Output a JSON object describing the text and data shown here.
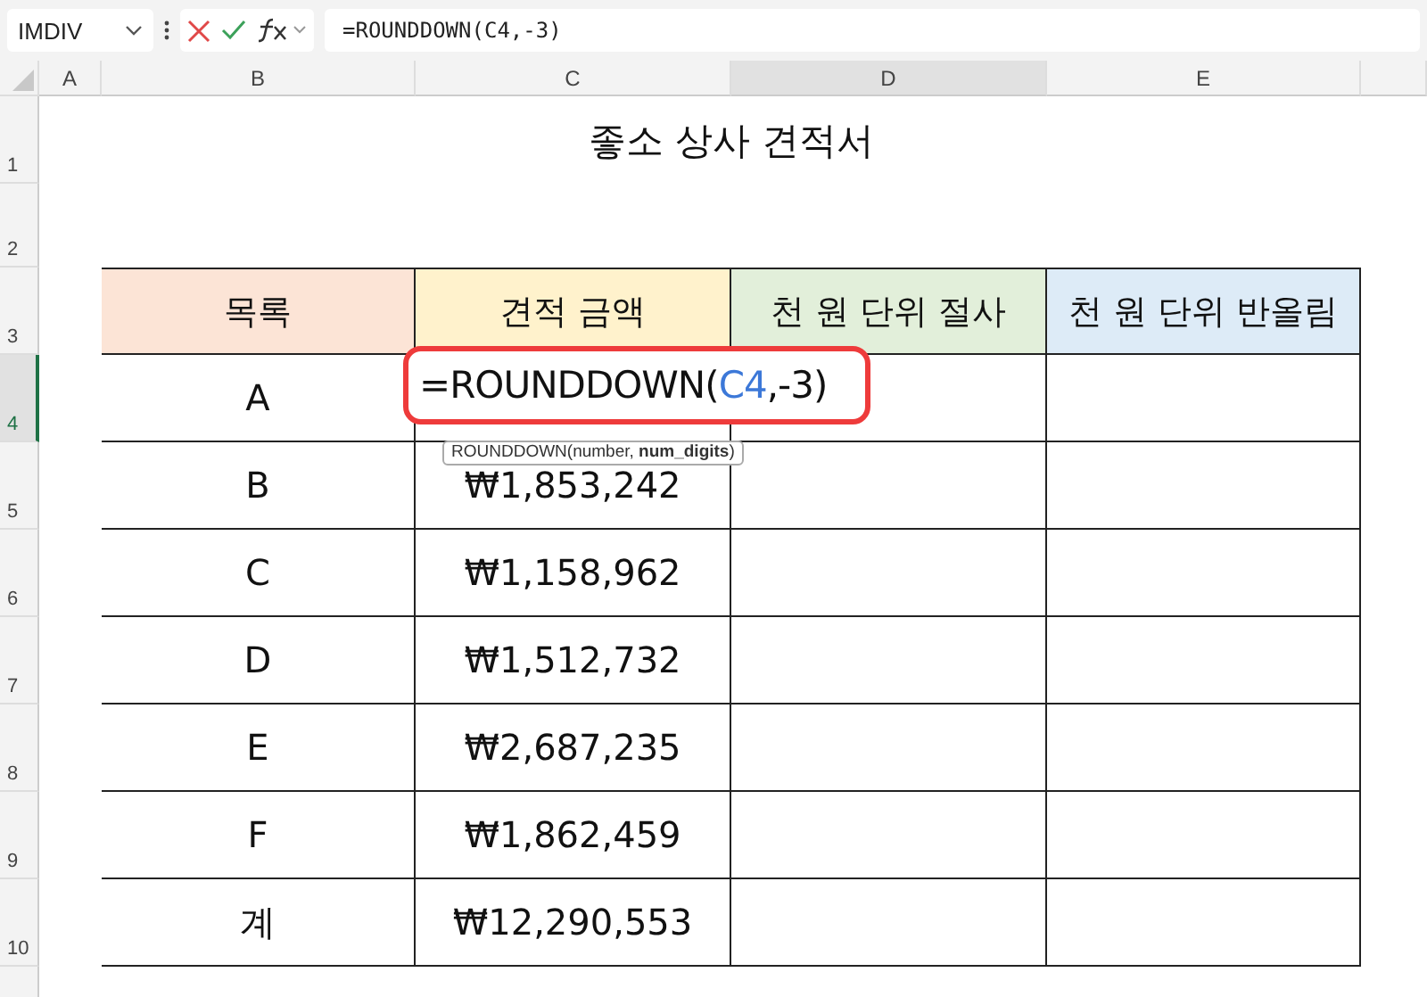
{
  "formula_bar": {
    "name_box": "IMDIV",
    "formula": "=ROUNDDOWN(C4,-3)"
  },
  "columns": [
    {
      "label": "A",
      "selected": false
    },
    {
      "label": "B",
      "selected": false
    },
    {
      "label": "C",
      "selected": false
    },
    {
      "label": "D",
      "selected": true
    },
    {
      "label": "E",
      "selected": false
    }
  ],
  "row_numbers": [
    {
      "label": "1",
      "selected": false
    },
    {
      "label": "2",
      "selected": false
    },
    {
      "label": "3",
      "selected": false
    },
    {
      "label": "4",
      "selected": true
    },
    {
      "label": "5",
      "selected": false
    },
    {
      "label": "6",
      "selected": false
    },
    {
      "label": "7",
      "selected": false
    },
    {
      "label": "8",
      "selected": false
    },
    {
      "label": "9",
      "selected": false
    },
    {
      "label": "10",
      "selected": false
    }
  ],
  "title": "좋소 상사 견적서",
  "table_headers": [
    {
      "text": "목록",
      "color": "#fce4d6"
    },
    {
      "text": "견적 금액",
      "color": "#fff2cc"
    },
    {
      "text": "천 원 단위 절사",
      "color": "#e2efda"
    },
    {
      "text": "천 원 단위 반올림",
      "color": "#ddebf7"
    }
  ],
  "table_rows": [
    {
      "item": "A",
      "amount": ""
    },
    {
      "item": "B",
      "amount": "₩1,853,242"
    },
    {
      "item": "C",
      "amount": "₩1,158,962"
    },
    {
      "item": "D",
      "amount": "₩1,512,732"
    },
    {
      "item": "E",
      "amount": "₩2,687,235"
    },
    {
      "item": "F",
      "amount": "₩1,862,459"
    },
    {
      "item": "계",
      "amount": "₩12,290,553"
    }
  ],
  "cell_editor": {
    "parts": [
      "=ROUNDDOWN(",
      "C4",
      ",-3)"
    ],
    "tooltip": "ROUNDDOWN(number, **num_digits**)"
  }
}
